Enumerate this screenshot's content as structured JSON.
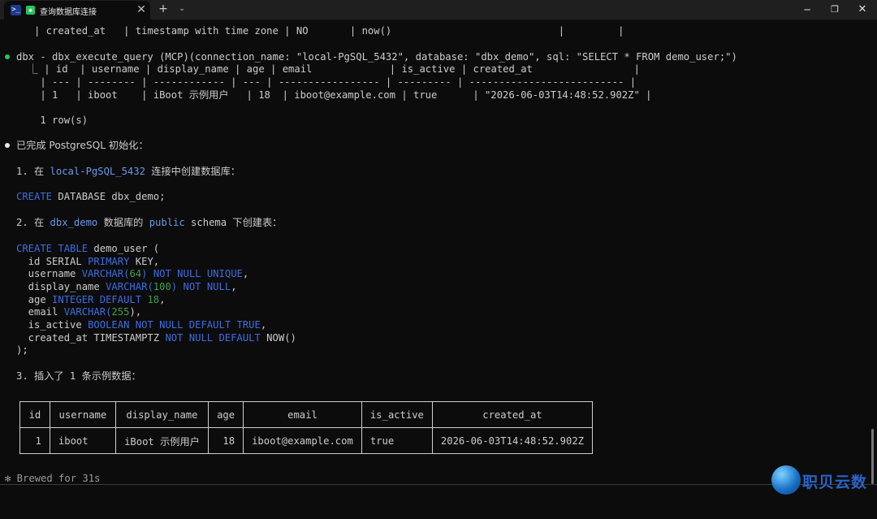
{
  "window": {
    "tab_title": "查询数据库连接",
    "app_icon": "terminal-icon",
    "status_icon": "task-status-icon",
    "close_glyph": "✕",
    "new_tab_glyph": "+",
    "dropdown_glyph": "⌄",
    "minimize_glyph": "─",
    "maximize_glyph": "❐",
    "window_close_glyph": "✕"
  },
  "terminal": {
    "top_schema_row": "   | created_at   | timestamp with time zone | NO       | now()                            |         |",
    "tool_call": "dbx - dbx_execute_query (MCP)(connection_name: \"local-PgSQL_5432\", database: \"dbx_demo\", sql: \"SELECT * FROM demo_user;\")",
    "result_header": "  ⎿ | id  | username | display_name | age | email             | is_active | created_at                 |",
    "result_sep": "    | --- | -------- | ------------ | --- | ----------------- | --------- | -------------------------- |",
    "result_row": "    | 1   | iboot    | iBoot 示例用户   | 18  | iboot@example.com | true      | \"2026-06-03T14:48:52.902Z\" |",
    "row_count": "    1 row(s)",
    "summary": "已完成 PostgreSQL 初始化：",
    "step1_prefix": "1. 在 ",
    "step1_conn": "local-PgSQL_5432",
    "step1_suffix": " 连接中创建数据库：",
    "create_db": {
      "kw": "CREATE",
      "rest": " DATABASE dbx_demo;"
    },
    "step2_prefix": "2. 在 ",
    "step2_db": "dbx_demo",
    "step2_mid": " 数据库的 ",
    "step2_schema": "public",
    "step2_suffix": " schema 下创建表：",
    "create_table": {
      "kw": "CREATE TABLE",
      "rest": " demo_user ("
    },
    "cols": {
      "id": {
        "name": "  id SERIAL ",
        "kw": "PRIMARY",
        "rest": " KEY,"
      },
      "username": {
        "name": "  username ",
        "type": "VARCHAR",
        "open": "(",
        "len": "64",
        "close": ") ",
        "kw": "NOT NULL UNIQUE",
        "end": ","
      },
      "display_name": {
        "name": "  display_name ",
        "type": "VARCHAR",
        "open": "(",
        "len": "100",
        "close": ") ",
        "kw": "NOT NULL",
        "end": ","
      },
      "age": {
        "name": "  age ",
        "kw": "INTEGER DEFAULT",
        "sp": " ",
        "num": "18",
        "end": ","
      },
      "email": {
        "name": "  email ",
        "type": "VARCHAR",
        "open": "(",
        "len": "255",
        "end": "),"
      },
      "is_active": {
        "name": "  is_active ",
        "kw": "BOOLEAN NOT NULL DEFAULT TRUE",
        "end": ","
      },
      "created_at": {
        "name": "  created_at TIMESTAMPTZ ",
        "kw": "NOT NULL DEFAULT",
        "rest": " NOW()"
      }
    },
    "close_paren": ");",
    "step3": "3. 插入了 1 条示例数据：",
    "table_headers": [
      "id",
      "username",
      "display_name",
      "age",
      "email",
      "is_active",
      "created_at"
    ],
    "table_row": [
      "1",
      "iboot",
      "iBoot 示例用户",
      "18",
      "iboot@example.com",
      "true",
      "2026-06-03T14:48:52.902Z"
    ],
    "brewed": "✻ Brewed for 31s"
  },
  "watermark": {
    "text": "职贝云数",
    "icon": "globe-logo-icon"
  },
  "colors": {
    "background": "#0c0c0c",
    "foreground": "#cccccc",
    "keyword": "#3b6de0",
    "number": "#3aa14a",
    "highlight": "#6b98e8",
    "success_bullet": "#22c55e"
  }
}
